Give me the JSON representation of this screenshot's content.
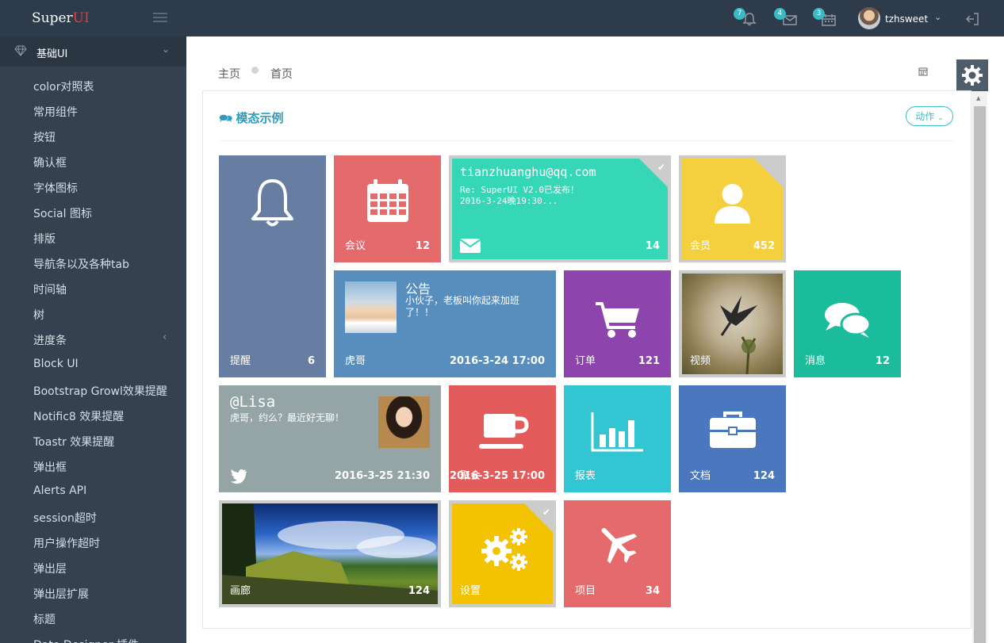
{
  "header": {
    "logo_main": "Super",
    "logo_accent": "UI",
    "notifications_badge": "7",
    "messages_badge": "4",
    "calendar_badge": "3",
    "username": "tzhsweet"
  },
  "sidebar": {
    "section_title": "基础UI",
    "items": [
      {
        "label": "color对照表"
      },
      {
        "label": "常用组件"
      },
      {
        "label": "按钮"
      },
      {
        "label": "确认框"
      },
      {
        "label": "字体图标"
      },
      {
        "label": "Social 图标"
      },
      {
        "label": "排版"
      },
      {
        "label": "导航条以及各种tab"
      },
      {
        "label": "时间轴"
      },
      {
        "label": "树"
      },
      {
        "label": "进度条"
      },
      {
        "label": "Block UI"
      },
      {
        "label": "Bootstrap Growl效果提醒"
      },
      {
        "label": "Notific8 效果提醒"
      },
      {
        "label": "Toastr 效果提醒"
      },
      {
        "label": "弹出框"
      },
      {
        "label": "Alerts API"
      },
      {
        "label": "session超时"
      },
      {
        "label": "用户操作超时"
      },
      {
        "label": "弹出层"
      },
      {
        "label": "弹出层扩展"
      },
      {
        "label": "标题"
      },
      {
        "label": "Date Designer 插件"
      }
    ]
  },
  "breadcrumb": {
    "home": "主页",
    "current": "首页"
  },
  "portlet": {
    "title": "模态示例",
    "action_label": "动作"
  },
  "colors": {
    "topbar": "#2e3b4a",
    "sidebar": "#364150",
    "accent": "#37bbc7",
    "title": "#2b9ec0"
  },
  "tiles": {
    "reminder": {
      "name": "提醒",
      "number": "6",
      "icon": "bell-icon",
      "color": "#677ea2"
    },
    "meeting": {
      "name": "会议",
      "number": "12",
      "icon": "calendar-icon",
      "color": "#e46a6b"
    },
    "mail": {
      "email": "tianzhuanghu@qq.com",
      "subject": "Re: SuperUI V2.0已发布！",
      "time": "2016-3-24晚19:30...",
      "number": "14",
      "icon": "envelope-icon",
      "color": "#36d7b7"
    },
    "member": {
      "name": "会员",
      "number": "452",
      "icon": "user-icon",
      "color": "#f4d03f"
    },
    "notice": {
      "heading": "公告",
      "text": "小伙子，老板叫你起来加班了！！",
      "name": "虎哥",
      "date": "2016-3-24 17:00",
      "color": "#578ebe"
    },
    "orders": {
      "name": "订单",
      "number": "121",
      "icon": "cart-icon",
      "color": "#8e44ad"
    },
    "video": {
      "name": "视频",
      "icon": "bird-photo"
    },
    "messages": {
      "name": "消息",
      "number": "12",
      "icon": "comments-icon",
      "color": "#1bbc9b"
    },
    "lisa": {
      "heading": "@Lisa",
      "text": "虎哥，约么？最近好无聊！",
      "date": "2016-3-25 21:30",
      "icon": "twitter-icon",
      "color": "#95a5a6"
    },
    "coffee": {
      "name": "聚会",
      "date": "2016-3-25 17:00",
      "icon": "coffee-icon",
      "color": "#e35b5a"
    },
    "report": {
      "name": "报表",
      "icon": "bar-chart-icon",
      "color": "#32c5d2"
    },
    "docs": {
      "name": "文档",
      "number": "124",
      "icon": "briefcase-icon",
      "color": "#4b77be"
    },
    "gallery": {
      "name": "画廊",
      "number": "124",
      "icon": "landscape-photo"
    },
    "settings": {
      "name": "设置",
      "icon": "gears-icon",
      "color": "#f3c200"
    },
    "project": {
      "name": "项目",
      "number": "34",
      "icon": "plane-icon",
      "color": "#e46a6b"
    }
  }
}
